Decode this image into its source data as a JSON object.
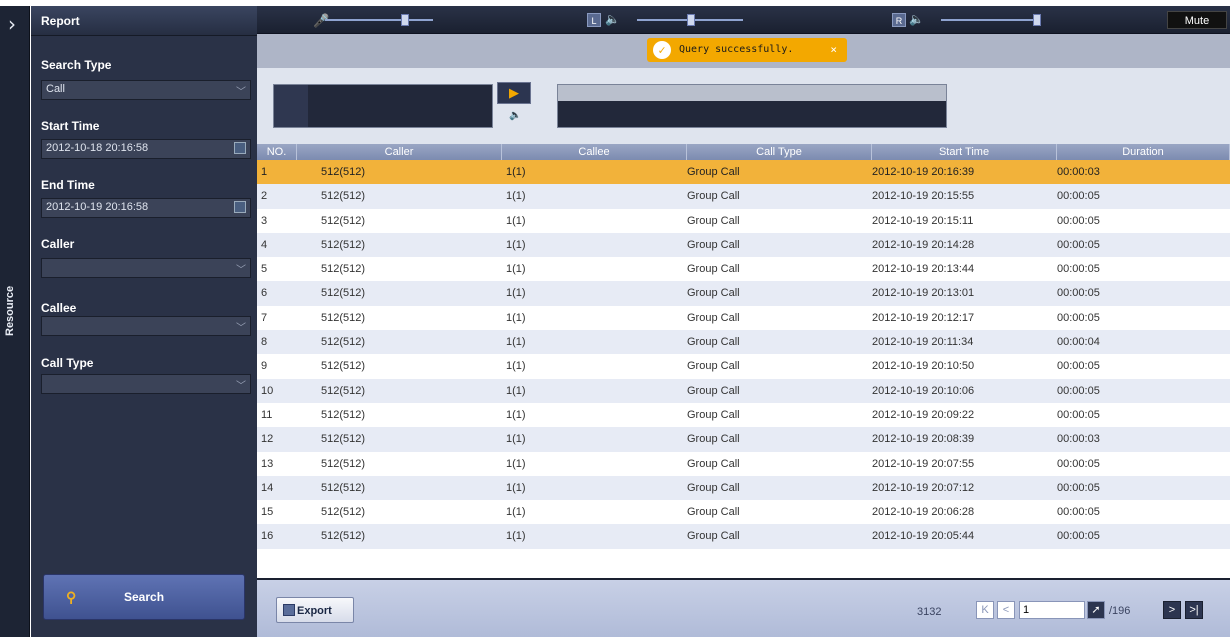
{
  "rail": {
    "label": "Resource",
    "expand_icon": "chevron-right-icon"
  },
  "left": {
    "title": "Report",
    "search_type_label": "Search Type",
    "search_type_value": "Call",
    "start_time_label": "Start Time",
    "start_time_value": "2012-10-18 20:16:58",
    "end_time_label": "End Time",
    "end_time_value": "2012-10-19 20:16:58",
    "caller_label": "Caller",
    "caller_value": "",
    "callee_label": "Callee",
    "callee_value": "",
    "call_type_label": "Call Type",
    "call_type_value": "",
    "search_label": "Search"
  },
  "audio": {
    "left_label": "L",
    "right_label": "R",
    "mute_label": "Mute"
  },
  "notification": {
    "message": "Query successfully.",
    "close": "×"
  },
  "table": {
    "headers": [
      "NO.",
      "Caller",
      "Callee",
      "Call Type",
      "Start Time",
      "Duration"
    ],
    "rows": [
      [
        "1",
        "512(512)",
        "1(1)",
        "Group Call",
        "2012-10-19 20:16:39",
        "00:00:03"
      ],
      [
        "2",
        "512(512)",
        "1(1)",
        "Group Call",
        "2012-10-19 20:15:55",
        "00:00:05"
      ],
      [
        "3",
        "512(512)",
        "1(1)",
        "Group Call",
        "2012-10-19 20:15:11",
        "00:00:05"
      ],
      [
        "4",
        "512(512)",
        "1(1)",
        "Group Call",
        "2012-10-19 20:14:28",
        "00:00:05"
      ],
      [
        "5",
        "512(512)",
        "1(1)",
        "Group Call",
        "2012-10-19 20:13:44",
        "00:00:05"
      ],
      [
        "6",
        "512(512)",
        "1(1)",
        "Group Call",
        "2012-10-19 20:13:01",
        "00:00:05"
      ],
      [
        "7",
        "512(512)",
        "1(1)",
        "Group Call",
        "2012-10-19 20:12:17",
        "00:00:05"
      ],
      [
        "8",
        "512(512)",
        "1(1)",
        "Group Call",
        "2012-10-19 20:11:34",
        "00:00:04"
      ],
      [
        "9",
        "512(512)",
        "1(1)",
        "Group Call",
        "2012-10-19 20:10:50",
        "00:00:05"
      ],
      [
        "10",
        "512(512)",
        "1(1)",
        "Group Call",
        "2012-10-19 20:10:06",
        "00:00:05"
      ],
      [
        "11",
        "512(512)",
        "1(1)",
        "Group Call",
        "2012-10-19 20:09:22",
        "00:00:05"
      ],
      [
        "12",
        "512(512)",
        "1(1)",
        "Group Call",
        "2012-10-19 20:08:39",
        "00:00:03"
      ],
      [
        "13",
        "512(512)",
        "1(1)",
        "Group Call",
        "2012-10-19 20:07:55",
        "00:00:05"
      ],
      [
        "14",
        "512(512)",
        "1(1)",
        "Group Call",
        "2012-10-19 20:07:12",
        "00:00:05"
      ],
      [
        "15",
        "512(512)",
        "1(1)",
        "Group Call",
        "2012-10-19 20:06:28",
        "00:00:05"
      ],
      [
        "16",
        "512(512)",
        "1(1)",
        "Group Call",
        "2012-10-19 20:05:44",
        "00:00:05"
      ]
    ],
    "selected_row": 0
  },
  "footer": {
    "export_label": "Export",
    "total_records": "3132",
    "page_value": "1",
    "page_total": "/196"
  },
  "colors": {
    "accent": "#f3a800",
    "selected_row": "#f2b23a",
    "panel": "#2a3247"
  }
}
